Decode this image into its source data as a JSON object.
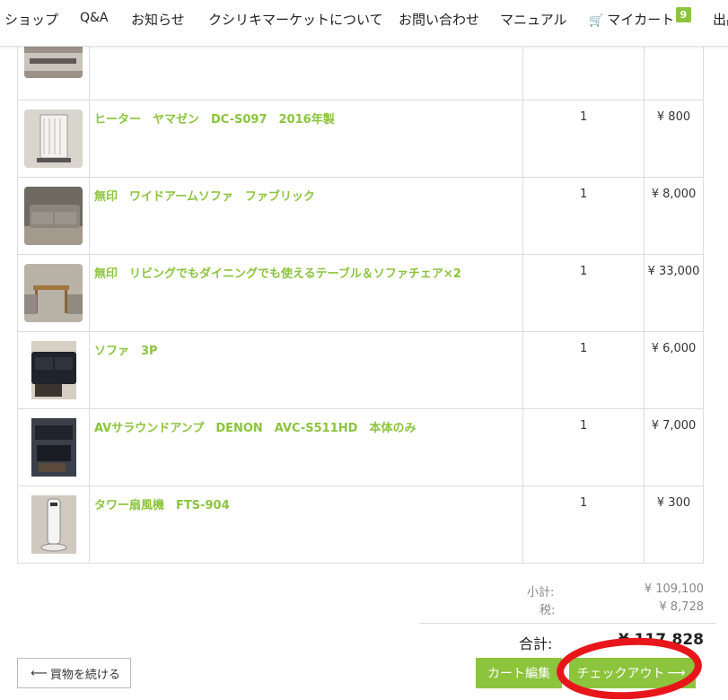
{
  "nav": {
    "shop": "ショップ",
    "qa": "Q&A",
    "news": "お知らせ",
    "about": "クシリキマーケットについて",
    "contact": "お問い合わせ",
    "manual": "マニュアル",
    "my_cart": "マイカート",
    "cart_count": "9",
    "cutoff": "出品"
  },
  "cart": {
    "items": [
      {
        "name": "",
        "qty": "",
        "price": ""
      },
      {
        "name": "ヒーター　ヤマゼン　DC-S097　2016年製",
        "qty": "1",
        "price": "¥ 800"
      },
      {
        "name": "無印　ワイドアームソファ　ファブリック",
        "qty": "1",
        "price": "¥ 8,000"
      },
      {
        "name": "無印　リビングでもダイニングでも使えるテーブル＆ソファチェア×2",
        "qty": "1",
        "price": "¥ 33,000"
      },
      {
        "name": "ソファ　3P",
        "qty": "1",
        "price": "¥ 6,000"
      },
      {
        "name": "AVサラウンドアンプ　DENON　AVC-S511HD　本体のみ",
        "qty": "1",
        "price": "¥ 7,000"
      },
      {
        "name": "タワー扇風機　FTS-904",
        "qty": "1",
        "price": "¥ 300"
      }
    ]
  },
  "totals": {
    "subtotal_label": "小計:",
    "subtotal_value": "¥ 109,100",
    "tax_label": "税:",
    "tax_value": "¥ 8,728",
    "total_label": "合計:",
    "total_value": "¥ 117,828"
  },
  "buttons": {
    "continue": "買物を続ける",
    "edit_cart": "カート編集",
    "checkout": "チェックアウト"
  },
  "colors": {
    "accent": "#8cc43d",
    "annotation": "#e8161b"
  }
}
